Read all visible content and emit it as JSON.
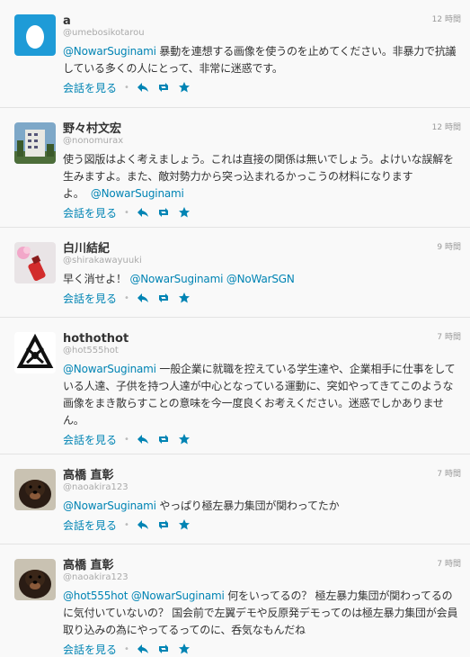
{
  "tweets": [
    {
      "name": "a",
      "handle": "@umebosikotarou",
      "time": "12 時間",
      "mention": "@NowarSuginami",
      "text": " 暴動を連想する画像を使うのを止めてください。非暴力で抗議している多くの人にとって、非常に迷惑です。",
      "conversation": "会話を見る",
      "avatar": "egg-avatar"
    },
    {
      "name": "野々村文宏",
      "handle": "@nonomurax",
      "time": "12 時間",
      "text": "使う図版はよく考えましょう。これは直接の関係は無いでしょう。よけいな誤解を生みますよ。また、敵対勢力から突っ込まれるかっこうの材料になりますよ。",
      "mention": "@NowarSuginami",
      "conversation": "会話を見る",
      "avatar": "building-avatar"
    },
    {
      "name": "白川結紀",
      "handle": "@shirakawayuuki",
      "time": "9 時間",
      "text": "早く消せよ！",
      "mention": "@NowarSuginami",
      "mention2": "@NoWarSGN",
      "conversation": "会話を見る",
      "avatar": "spray-avatar"
    },
    {
      "name": "hothothot",
      "handle": "@hot555hot",
      "time": "7 時間",
      "mention": "@NowarSuginami",
      "text": " 一般企業に就職を控えている学生達や、企業相手に仕事をしている人達、子供を持つ人達が中心となっている運動に、突如やってきてこのような画像をまき散らすことの意味を今一度良くお考えください。迷惑でしかありません。",
      "conversation": "会話を見る",
      "avatar": "logo-avatar"
    },
    {
      "name": "高橋 直彰",
      "handle": "@naoakira123",
      "time": "7 時間",
      "mention": "@NowarSuginami",
      "text": " やっぱり極左暴力集団が関わってたか",
      "conversation": "会話を見る",
      "avatar": "dog-avatar"
    },
    {
      "name": "高橋 直彰",
      "handle": "@naoakira123",
      "time": "7 時間",
      "mention": "@hot555hot",
      "mention2": "@NowarSuginami",
      "text": " 何をいってるの？ 極左暴力集団が関わってるのに気付いていないの？ 国会前で左翼デモや反原発デモってのは極左暴力集団が会員取り込みの為にやってるってのに、呑気なもんだね",
      "conversation": "会話を見る",
      "avatar": "dog-avatar"
    }
  ],
  "colors": {
    "link": "#0084b4",
    "background": "#f9f9f9",
    "muted": "#999999"
  }
}
